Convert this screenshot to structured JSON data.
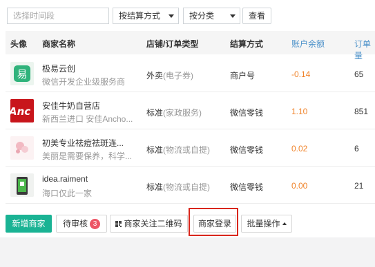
{
  "filters": {
    "time_placeholder": "选择时间段",
    "settlement_select": "按结算方式",
    "category_select": "按分类",
    "query_label": "查看"
  },
  "table": {
    "headers": {
      "avatar": "头像",
      "name": "商家名称",
      "store_type": "店铺/订单类型",
      "settlement": "结算方式",
      "balance": "账户余额",
      "orders": "订单量"
    },
    "rows": [
      {
        "avatar_icon": "yi-logo-icon",
        "name": "极易云创",
        "desc": "微信开发企业级服务商",
        "type_main": "外卖",
        "type_sub": "(电子券)",
        "settlement": "商户号",
        "balance": "-0.14",
        "orders": "65"
      },
      {
        "avatar_icon": "anchor-logo-icon",
        "name": "安佳牛奶自营店",
        "desc": "新西兰进口 安佳Ancho...",
        "type_main": "标准",
        "type_sub": "(家政服务)",
        "settlement": "微信零钱",
        "balance": "1.10",
        "orders": "851"
      },
      {
        "avatar_icon": "flower-photo-icon",
        "name": "初美专业祛痘祛斑连...",
        "desc": "美丽是需要保养，科学...",
        "type_main": "标准",
        "type_sub": "(物流或自提)",
        "settlement": "微信零钱",
        "balance": "0.02",
        "orders": "6"
      },
      {
        "avatar_icon": "phone-app-icon",
        "name": "idea.raiment",
        "desc": "海口仅此一家",
        "type_main": "标准",
        "type_sub": "(物流或自提)",
        "settlement": "微信零钱",
        "balance": "0.00",
        "orders": "21"
      }
    ]
  },
  "actions": {
    "add_merchant": "新增商家",
    "pending_review": "待审核",
    "pending_count": "3",
    "qr_code": "商家关注二维码",
    "merchant_login": "商家登录",
    "batch_ops": "批量操作"
  },
  "colors": {
    "accent_green": "#1ab394",
    "balance_orange": "#f0832a",
    "header_blue": "#4a90c9",
    "badge_red": "#ed5565",
    "highlight_red": "#d9261c"
  }
}
